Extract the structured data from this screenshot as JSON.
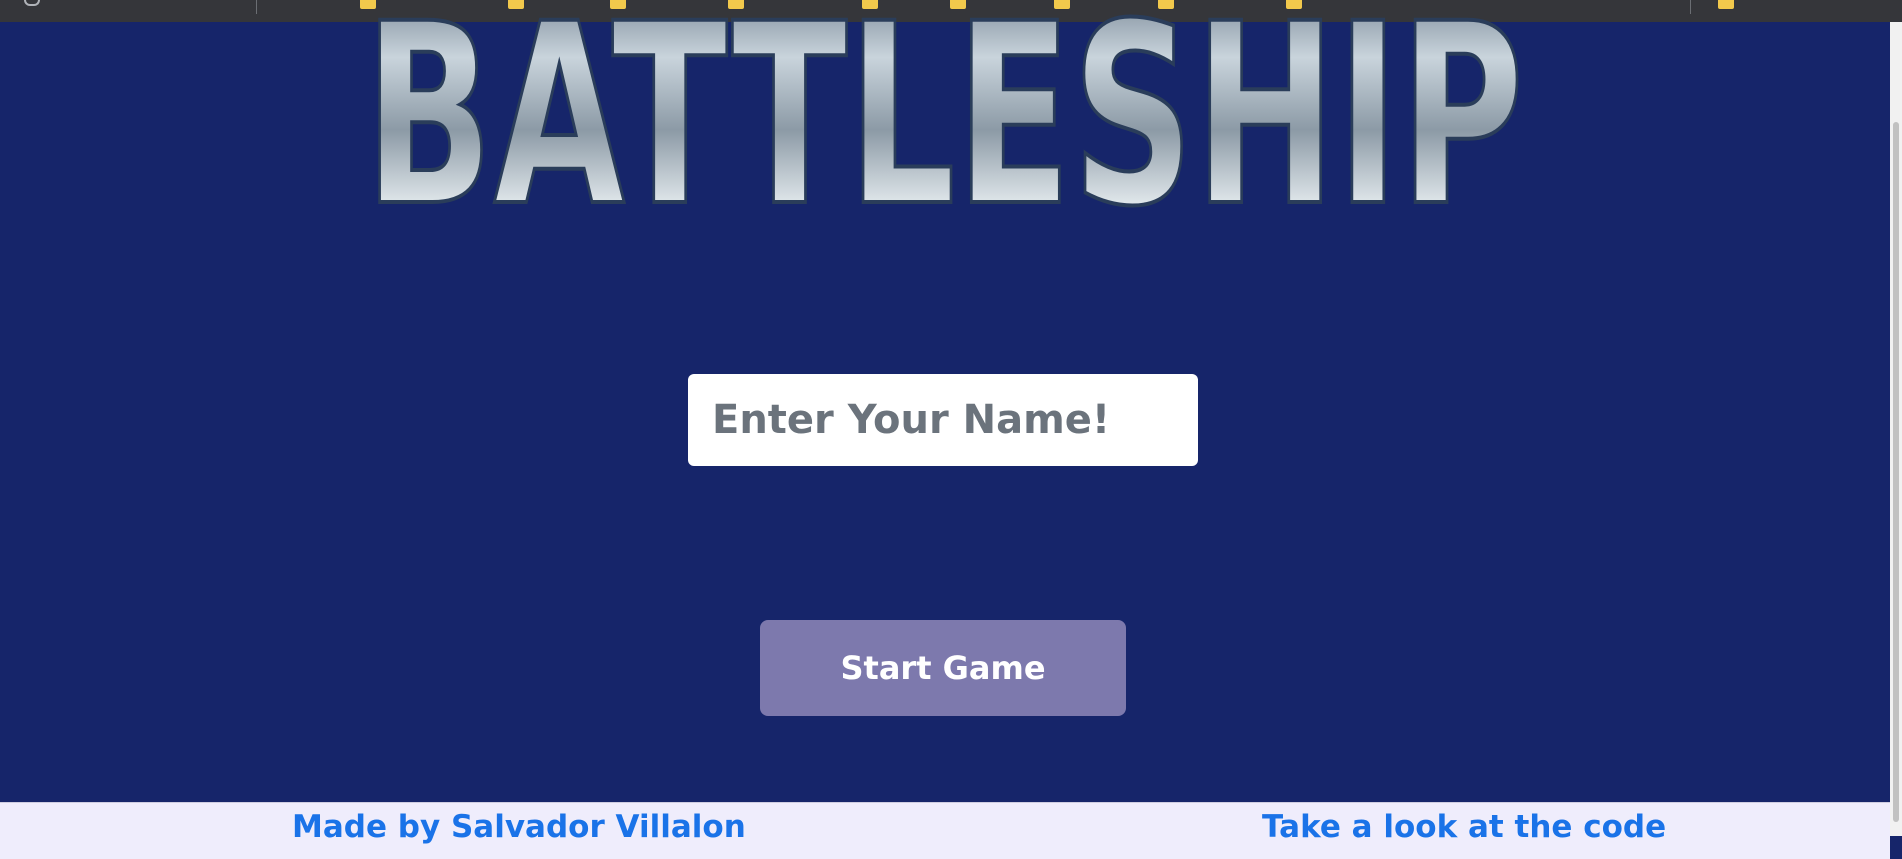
{
  "header": {
    "logo_text": "BATTLESHIP",
    "logo_icon": "battleship-logo"
  },
  "form": {
    "name_placeholder": "Enter Your Name!",
    "name_value": "",
    "start_label": "Start Game"
  },
  "footer": {
    "credit_label": "Made by Salvador Villalon",
    "code_link_label": "Take a look at the code"
  },
  "colors": {
    "background": "#16256a",
    "button": "#7d79ad",
    "footer_bg": "#efedfc",
    "link": "#1a73e8"
  }
}
